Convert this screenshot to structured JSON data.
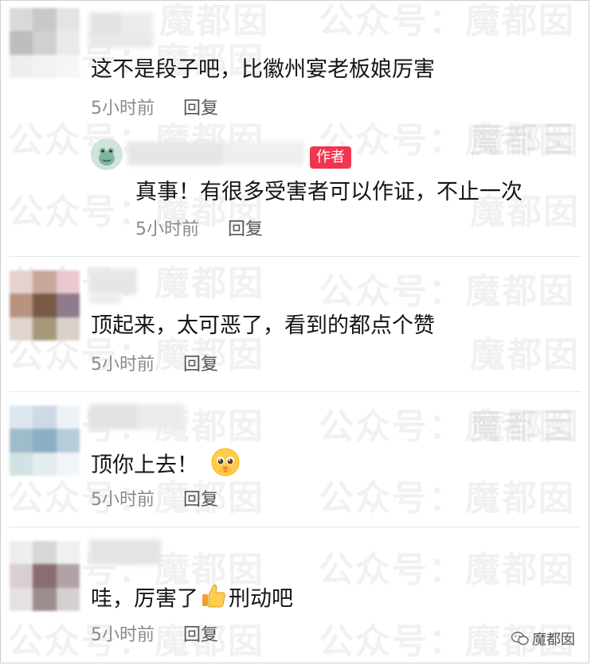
{
  "watermarks": {
    "text_a": "公众号：魔都囡",
    "text_b": "魔都囡"
  },
  "comments": [
    {
      "text": "这不是段子吧，比徽州宴老板娘厉害",
      "time": "5小时前",
      "reply_label": "回复",
      "reply": {
        "badge": "作者",
        "text": "真事！有很多受害者可以作证，不止一次",
        "time": "5小时前",
        "reply_label": "回复"
      }
    },
    {
      "text": "顶起来，太可恶了，看到的都点个赞",
      "time": "5小时前",
      "reply_label": "回复"
    },
    {
      "text": "顶你上去！",
      "emoji": "pleading-face",
      "time": "5小时前",
      "reply_label": "回复"
    },
    {
      "text_before": "哇，厉害了",
      "emoji": "thumbs-up",
      "text_after": "刑动吧",
      "time": "5小时前",
      "reply_label": "回复"
    }
  ],
  "footer_logo": "魔都囡",
  "colors": {
    "badge": "#f2354e",
    "meta": "#8a8a8a",
    "divider": "#e6e6e6"
  }
}
